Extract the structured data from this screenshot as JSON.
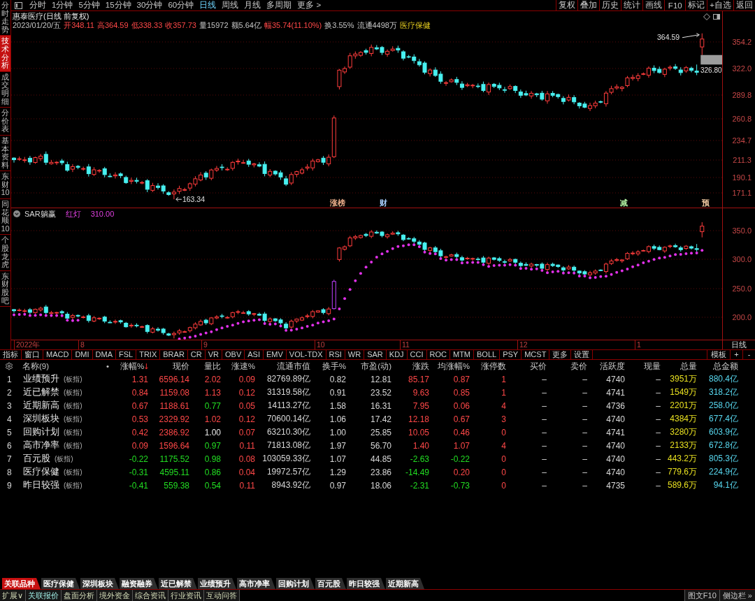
{
  "side_tabs": [
    {
      "label": "分时走势",
      "selected": false
    },
    {
      "label": "技术分析",
      "selected": true
    },
    {
      "label": "成交明细",
      "selected": false
    },
    {
      "label": "分价表",
      "selected": false
    },
    {
      "label": "基本资料",
      "selected": false
    },
    {
      "label": "东财10",
      "selected": false
    },
    {
      "label": "同花顺10",
      "selected": false
    },
    {
      "label": "个股龙虎",
      "selected": false
    },
    {
      "label": "东财股吧",
      "selected": false
    }
  ],
  "toolbar": {
    "periods": [
      {
        "label": "分时",
        "selected": false
      },
      {
        "label": "1分钟",
        "selected": false
      },
      {
        "label": "5分钟",
        "selected": false
      },
      {
        "label": "15分钟",
        "selected": false
      },
      {
        "label": "30分钟",
        "selected": false
      },
      {
        "label": "60分钟",
        "selected": false
      },
      {
        "label": "日线",
        "selected": true
      },
      {
        "label": "周线",
        "selected": false
      },
      {
        "label": "月线",
        "selected": false
      },
      {
        "label": "多周期",
        "selected": false
      },
      {
        "label": "更多 >",
        "selected": false
      }
    ],
    "actions": [
      "复权",
      "叠加",
      "历史",
      "统计",
      "画线",
      "F10",
      "标记",
      "+自选",
      "返回"
    ]
  },
  "price_panel": {
    "title": "惠泰医疗(日线 前复权)",
    "quote": [
      {
        "text": "2023/01/20/五",
        "kind": "plain"
      },
      {
        "text": "开348.11",
        "kind": "up"
      },
      {
        "text": "高364.59",
        "kind": "up"
      },
      {
        "text": "低338.33",
        "kind": "up"
      },
      {
        "text": "收357.73",
        "kind": "up"
      },
      {
        "text": "量15972",
        "kind": "plain"
      },
      {
        "text": "额5.64亿",
        "kind": "plain"
      },
      {
        "text": "幅35.74(11.10%)",
        "kind": "up"
      },
      {
        "text": "换3.55%",
        "kind": "plain"
      },
      {
        "text": "流通4498万",
        "kind": "plain"
      },
      {
        "text": "医疗保健",
        "kind": "highlight"
      }
    ],
    "axis": [
      "354.2",
      "322.0",
      "289.8",
      "260.8",
      "234.7",
      "211.3",
      "190.1",
      "171.1"
    ],
    "high_label": "364.59",
    "low_label": "163.34",
    "gap_label": "326.80",
    "events": [
      {
        "label": "涨榜",
        "color": "#f0b08c"
      },
      {
        "label": "财",
        "color": "#a8d0ff"
      },
      {
        "label": "减",
        "color": "#b0f0a0"
      },
      {
        "label": "预",
        "color": "#f0c8a0"
      }
    ]
  },
  "sar_panel": {
    "name": "SAR躺赢",
    "signal": "红灯",
    "value": "310.00",
    "axis": [
      "350.0",
      "300.0",
      "250.0",
      "200.0"
    ]
  },
  "date_axis": {
    "labels": [
      "2022年",
      "8",
      "9",
      "10",
      "11",
      "12",
      "1"
    ],
    "period": "日线"
  },
  "indicator_bar": {
    "items": [
      "指标",
      "窗口",
      "MACD",
      "DMI",
      "DMA",
      "FSL",
      "TRIX",
      "BRAR",
      "CR",
      "VR",
      "OBV",
      "ASI",
      "EMV",
      "VOL-TDX",
      "RSI",
      "WR",
      "SAR",
      "KDJ",
      "CCI",
      "ROC",
      "MTM",
      "BOLL",
      "PSY",
      "MCST",
      "更多",
      "设置"
    ],
    "tools": [
      "模板",
      "+",
      "-"
    ]
  },
  "table": {
    "name_header": "名称(9)",
    "marker": "•",
    "columns": [
      {
        "label": "涨幅%",
        "sorted": true
      },
      {
        "label": "现价",
        "sorted": false
      },
      {
        "label": "量比",
        "sorted": false
      },
      {
        "label": "涨速%",
        "sorted": false
      },
      {
        "label": "流通市值",
        "sorted": false
      },
      {
        "label": "换手%",
        "sorted": false
      },
      {
        "label": "市盈(动)",
        "sorted": false
      },
      {
        "label": "涨跌",
        "sorted": false
      },
      {
        "label": "均涨幅%",
        "sorted": false
      },
      {
        "label": "涨停数",
        "sorted": false
      },
      {
        "label": "买价",
        "sorted": false
      },
      {
        "label": "卖价",
        "sorted": false
      },
      {
        "label": "活跃度",
        "sorted": false
      },
      {
        "label": "现量",
        "sorted": false
      },
      {
        "label": "总量",
        "sorted": false
      },
      {
        "label": "总金额",
        "sorted": false
      }
    ],
    "rows": [
      {
        "index": "1",
        "name": "业绩预升",
        "tag": "(板指)",
        "cells": [
          {
            "text": "1.31",
            "kind": "up"
          },
          {
            "text": "6596.14",
            "kind": "up"
          },
          {
            "text": "2.02",
            "kind": "up"
          },
          {
            "text": "0.09",
            "kind": "up"
          },
          {
            "text": "82769.89亿",
            "kind": "plain"
          },
          {
            "text": "0.82",
            "kind": "plain"
          },
          {
            "text": "12.81",
            "kind": "plain"
          },
          {
            "text": "85.17",
            "kind": "up"
          },
          {
            "text": "0.87",
            "kind": "up"
          },
          {
            "text": "1",
            "kind": "up"
          },
          {
            "text": "–",
            "kind": "plain"
          },
          {
            "text": "–",
            "kind": "plain"
          },
          {
            "text": "4740",
            "kind": "plain"
          },
          {
            "text": "–",
            "kind": "plain"
          },
          {
            "text": "3951万",
            "kind": "volume"
          },
          {
            "text": "880.4亿",
            "kind": "amount"
          }
        ]
      },
      {
        "index": "2",
        "name": "近已解禁",
        "tag": "(板指)",
        "cells": [
          {
            "text": "0.84",
            "kind": "up"
          },
          {
            "text": "1159.08",
            "kind": "up"
          },
          {
            "text": "1.13",
            "kind": "up"
          },
          {
            "text": "0.12",
            "kind": "up"
          },
          {
            "text": "31319.58亿",
            "kind": "plain"
          },
          {
            "text": "0.91",
            "kind": "plain"
          },
          {
            "text": "23.52",
            "kind": "plain"
          },
          {
            "text": "9.63",
            "kind": "up"
          },
          {
            "text": "0.85",
            "kind": "up"
          },
          {
            "text": "1",
            "kind": "up"
          },
          {
            "text": "–",
            "kind": "plain"
          },
          {
            "text": "–",
            "kind": "plain"
          },
          {
            "text": "4741",
            "kind": "plain"
          },
          {
            "text": "–",
            "kind": "plain"
          },
          {
            "text": "1549万",
            "kind": "volume"
          },
          {
            "text": "318.2亿",
            "kind": "amount"
          }
        ]
      },
      {
        "index": "3",
        "name": "近期新高",
        "tag": "(板指)",
        "cells": [
          {
            "text": "0.67",
            "kind": "up"
          },
          {
            "text": "1188.61",
            "kind": "up"
          },
          {
            "text": "0.77",
            "kind": "down"
          },
          {
            "text": "0.05",
            "kind": "up"
          },
          {
            "text": "14113.27亿",
            "kind": "plain"
          },
          {
            "text": "1.58",
            "kind": "plain"
          },
          {
            "text": "16.31",
            "kind": "plain"
          },
          {
            "text": "7.95",
            "kind": "up"
          },
          {
            "text": "0.06",
            "kind": "up"
          },
          {
            "text": "4",
            "kind": "up"
          },
          {
            "text": "–",
            "kind": "plain"
          },
          {
            "text": "–",
            "kind": "plain"
          },
          {
            "text": "4736",
            "kind": "plain"
          },
          {
            "text": "–",
            "kind": "plain"
          },
          {
            "text": "2201万",
            "kind": "volume"
          },
          {
            "text": "258.0亿",
            "kind": "amount"
          }
        ]
      },
      {
        "index": "4",
        "name": "深圳板块",
        "tag": "(板指)",
        "cells": [
          {
            "text": "0.53",
            "kind": "up"
          },
          {
            "text": "2329.92",
            "kind": "up"
          },
          {
            "text": "1.02",
            "kind": "up"
          },
          {
            "text": "0.12",
            "kind": "up"
          },
          {
            "text": "70600.14亿",
            "kind": "plain"
          },
          {
            "text": "1.06",
            "kind": "plain"
          },
          {
            "text": "17.42",
            "kind": "plain"
          },
          {
            "text": "12.18",
            "kind": "up"
          },
          {
            "text": "0.67",
            "kind": "up"
          },
          {
            "text": "3",
            "kind": "up"
          },
          {
            "text": "–",
            "kind": "plain"
          },
          {
            "text": "–",
            "kind": "plain"
          },
          {
            "text": "4740",
            "kind": "plain"
          },
          {
            "text": "–",
            "kind": "plain"
          },
          {
            "text": "4384万",
            "kind": "volume"
          },
          {
            "text": "677.4亿",
            "kind": "amount"
          }
        ]
      },
      {
        "index": "5",
        "name": "回购计划",
        "tag": "(板指)",
        "cells": [
          {
            "text": "0.42",
            "kind": "up"
          },
          {
            "text": "2386.92",
            "kind": "up"
          },
          {
            "text": "1.00",
            "kind": "flat"
          },
          {
            "text": "0.07",
            "kind": "up"
          },
          {
            "text": "63210.30亿",
            "kind": "plain"
          },
          {
            "text": "1.00",
            "kind": "plain"
          },
          {
            "text": "25.85",
            "kind": "plain"
          },
          {
            "text": "10.05",
            "kind": "up"
          },
          {
            "text": "0.46",
            "kind": "up"
          },
          {
            "text": "0",
            "kind": "up"
          },
          {
            "text": "–",
            "kind": "plain"
          },
          {
            "text": "–",
            "kind": "plain"
          },
          {
            "text": "4741",
            "kind": "plain"
          },
          {
            "text": "–",
            "kind": "plain"
          },
          {
            "text": "3280万",
            "kind": "volume"
          },
          {
            "text": "603.9亿",
            "kind": "amount"
          }
        ]
      },
      {
        "index": "6",
        "name": "高市净率",
        "tag": "(板指)",
        "cells": [
          {
            "text": "0.09",
            "kind": "up"
          },
          {
            "text": "1596.64",
            "kind": "up"
          },
          {
            "text": "0.97",
            "kind": "down"
          },
          {
            "text": "0.11",
            "kind": "up"
          },
          {
            "text": "71813.08亿",
            "kind": "plain"
          },
          {
            "text": "1.97",
            "kind": "plain"
          },
          {
            "text": "56.70",
            "kind": "plain"
          },
          {
            "text": "1.40",
            "kind": "up"
          },
          {
            "text": "1.07",
            "kind": "up"
          },
          {
            "text": "4",
            "kind": "up"
          },
          {
            "text": "–",
            "kind": "plain"
          },
          {
            "text": "–",
            "kind": "plain"
          },
          {
            "text": "4740",
            "kind": "plain"
          },
          {
            "text": "–",
            "kind": "plain"
          },
          {
            "text": "2133万",
            "kind": "volume"
          },
          {
            "text": "672.8亿",
            "kind": "amount"
          }
        ]
      },
      {
        "index": "7",
        "name": "百元股",
        "tag": "(板指)",
        "cells": [
          {
            "text": "-0.22",
            "kind": "down"
          },
          {
            "text": "1175.52",
            "kind": "down"
          },
          {
            "text": "0.98",
            "kind": "down"
          },
          {
            "text": "0.08",
            "kind": "up"
          },
          {
            "text": "103059.33亿",
            "kind": "plain"
          },
          {
            "text": "1.07",
            "kind": "plain"
          },
          {
            "text": "44.85",
            "kind": "plain"
          },
          {
            "text": "-2.63",
            "kind": "down"
          },
          {
            "text": "-0.22",
            "kind": "down"
          },
          {
            "text": "0",
            "kind": "up"
          },
          {
            "text": "–",
            "kind": "plain"
          },
          {
            "text": "–",
            "kind": "plain"
          },
          {
            "text": "4740",
            "kind": "plain"
          },
          {
            "text": "–",
            "kind": "plain"
          },
          {
            "text": "443.2万",
            "kind": "volume"
          },
          {
            "text": "805.3亿",
            "kind": "amount"
          }
        ]
      },
      {
        "index": "8",
        "name": "医疗保健",
        "tag": "(板指)",
        "cells": [
          {
            "text": "-0.31",
            "kind": "down"
          },
          {
            "text": "4595.11",
            "kind": "down"
          },
          {
            "text": "0.86",
            "kind": "down"
          },
          {
            "text": "0.04",
            "kind": "up"
          },
          {
            "text": "19972.57亿",
            "kind": "plain"
          },
          {
            "text": "1.29",
            "kind": "plain"
          },
          {
            "text": "23.86",
            "kind": "plain"
          },
          {
            "text": "-14.49",
            "kind": "down"
          },
          {
            "text": "0.20",
            "kind": "up"
          },
          {
            "text": "0",
            "kind": "up"
          },
          {
            "text": "–",
            "kind": "plain"
          },
          {
            "text": "–",
            "kind": "plain"
          },
          {
            "text": "4740",
            "kind": "plain"
          },
          {
            "text": "–",
            "kind": "plain"
          },
          {
            "text": "779.6万",
            "kind": "volume"
          },
          {
            "text": "224.9亿",
            "kind": "amount"
          }
        ]
      },
      {
        "index": "9",
        "name": "昨日较强",
        "tag": "(板指)",
        "cells": [
          {
            "text": "-0.41",
            "kind": "down"
          },
          {
            "text": "559.38",
            "kind": "down"
          },
          {
            "text": "0.54",
            "kind": "down"
          },
          {
            "text": "0.11",
            "kind": "up"
          },
          {
            "text": "8943.92亿",
            "kind": "plain"
          },
          {
            "text": "0.97",
            "kind": "plain"
          },
          {
            "text": "18.06",
            "kind": "plain"
          },
          {
            "text": "-2.31",
            "kind": "down"
          },
          {
            "text": "-0.73",
            "kind": "down"
          },
          {
            "text": "0",
            "kind": "up"
          },
          {
            "text": "–",
            "kind": "plain"
          },
          {
            "text": "–",
            "kind": "plain"
          },
          {
            "text": "4735",
            "kind": "plain"
          },
          {
            "text": "–",
            "kind": "plain"
          },
          {
            "text": "589.6万",
            "kind": "volume"
          },
          {
            "text": "94.1亿",
            "kind": "amount"
          }
        ]
      }
    ]
  },
  "bottom_tabs": [
    {
      "label": "关联品种",
      "selected": true
    },
    {
      "label": "医疗保健",
      "selected": false
    },
    {
      "label": "深圳板块",
      "selected": false
    },
    {
      "label": "融资融券",
      "selected": false
    },
    {
      "label": "近已解禁",
      "selected": false
    },
    {
      "label": "业绩预升",
      "selected": false
    },
    {
      "label": "高市净率",
      "selected": false
    },
    {
      "label": "回购计划",
      "selected": false
    },
    {
      "label": "百元股",
      "selected": false
    },
    {
      "label": "昨日较强",
      "selected": false
    },
    {
      "label": "近期新高",
      "selected": false
    }
  ],
  "bottom_links": [
    {
      "label": "扩展∨",
      "selected": false
    },
    {
      "label": "关联报价",
      "selected": true
    },
    {
      "label": "盘面分析",
      "selected": false
    },
    {
      "label": "境外资金",
      "selected": false
    },
    {
      "label": "综合资讯",
      "selected": false
    },
    {
      "label": "行业资讯",
      "selected": false
    },
    {
      "label": "互动问答",
      "selected": false
    }
  ],
  "bottom_right": [
    "图文F10",
    "侧边栏 »"
  ]
}
